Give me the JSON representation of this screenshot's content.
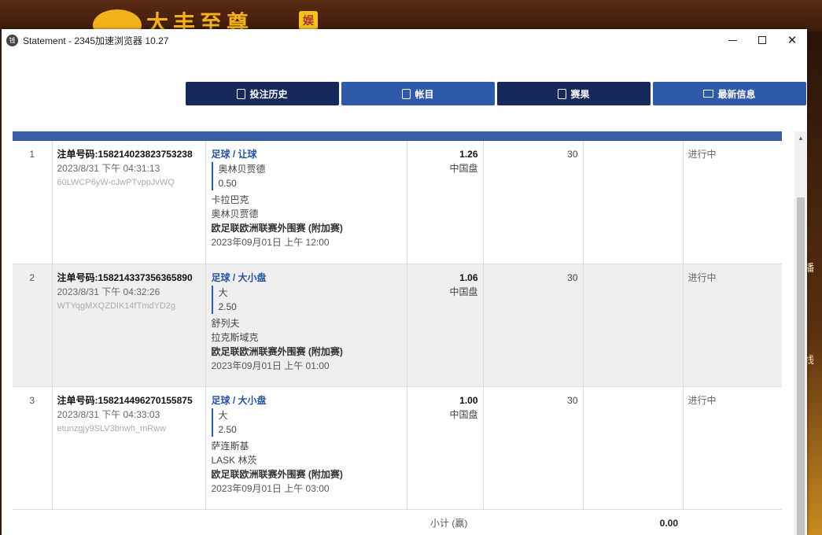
{
  "background": {
    "logo_text": "大丰至尊",
    "badge": "娱",
    "side_labels": [
      "播",
      "线"
    ]
  },
  "window": {
    "title": "Statement - 2345加速浏览器 10.27",
    "app_icon": "钱"
  },
  "nav": [
    {
      "label": "投注历史",
      "icon": "ticket-icon",
      "style": "dark"
    },
    {
      "label": "帐目",
      "icon": "ledger-icon",
      "style": "light"
    },
    {
      "label": "赛果",
      "icon": "result-icon",
      "style": "dark"
    },
    {
      "label": "最新信息",
      "icon": "mail-icon",
      "style": "light"
    }
  ],
  "rows": [
    {
      "num": "1",
      "ticket_id": "注单号码:158214023823753238",
      "time": "2023/8/31 下午 04:31:13",
      "ref": "60LWCP6yW-cJwPTvppJvWQ",
      "bet_type": "足球 / 让球",
      "selection": "奥林贝贾德",
      "handicap": "0.50",
      "home": "卡拉巴克",
      "away": "奥林贝贾德",
      "league": "欧足联欧洲联赛外围赛 (附加赛)",
      "match_time": "2023年09月01日 上午 12:00",
      "odds": "1.26",
      "odds_type": "中国盘",
      "stake": "30",
      "status": "进行中"
    },
    {
      "num": "2",
      "ticket_id": "注单号码:158214337356365890",
      "time": "2023/8/31 下午 04:32:26",
      "ref": "WTYqgMXQZDIK14fTmdYD2g",
      "bet_type": "足球 / 大小盘",
      "selection": "大",
      "handicap": "2.50",
      "home": "舒列夫",
      "away": "拉克斯域克",
      "league": "欧足联欧洲联赛外围赛 (附加赛)",
      "match_time": "2023年09月01日 上午 01:00",
      "odds": "1.06",
      "odds_type": "中国盘",
      "stake": "30",
      "status": "进行中"
    },
    {
      "num": "3",
      "ticket_id": "注单号码:158214496270155875",
      "time": "2023/8/31 下午 04:33:03",
      "ref": "etunzgjy9SLV3bnwh_mRww",
      "bet_type": "足球 / 大小盘",
      "selection": "大",
      "handicap": "2.50",
      "home": "萨连斯基",
      "away": "LASK 林茨",
      "league": "欧足联欧洲联赛外围赛 (附加赛)",
      "match_time": "2023年09月01日 上午 03:00",
      "odds": "1.00",
      "odds_type": "中国盘",
      "stake": "30",
      "status": "进行中"
    }
  ],
  "subtotal": {
    "label": "小计 (赢)",
    "value": "0.00"
  }
}
